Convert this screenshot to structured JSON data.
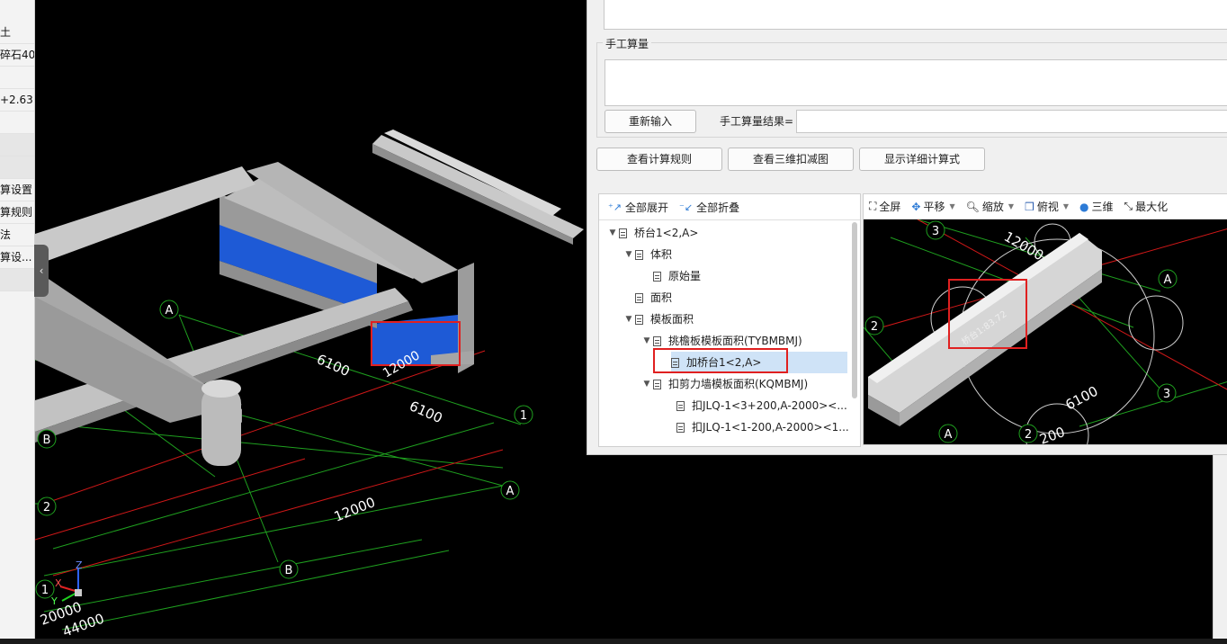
{
  "left_panel": {
    "rows": [
      "土",
      "碎石40",
      "",
      "+2.63.",
      "",
      "",
      "",
      "算设置",
      "算规则",
      "法",
      "算设..."
    ]
  },
  "viewport": {
    "axis_labels": [
      "A",
      "B",
      "2",
      "1",
      "A",
      "B",
      "1"
    ],
    "dims": [
      "6100",
      "6100",
      "12000",
      "12000",
      "20000",
      "44000"
    ],
    "gizmo": {
      "x": "X",
      "y": "Y",
      "z": "Z"
    }
  },
  "panel": {
    "manual_group_title": "手工算量",
    "reinput_button": "重新输入",
    "result_label": "手工算量结果=",
    "view_rules_button": "查看计算规则",
    "view_3d_button": "查看三维扣减图",
    "show_formula_button": "显示详细计算式"
  },
  "tree_toolbar": {
    "expand_all": "全部展开",
    "collapse_all": "全部折叠"
  },
  "tree": [
    {
      "label": "桥台1<2,A>",
      "level": 0,
      "arrow": "down"
    },
    {
      "label": "体积",
      "level": 1,
      "arrow": "down"
    },
    {
      "label": "原始量",
      "level": 2,
      "arrow": "none"
    },
    {
      "label": "面积",
      "level": 1,
      "arrow": "none"
    },
    {
      "label": "模板面积",
      "level": 1,
      "arrow": "down"
    },
    {
      "label": "挑檐板模板面积(TYBMBMJ)",
      "level": 2,
      "arrow": "down"
    },
    {
      "label": "加桥台1<2,A>",
      "level": 3,
      "arrow": "none",
      "selected": true
    },
    {
      "label": "扣剪力墙模板面积(KQMBMJ)",
      "level": 2,
      "arrow": "down"
    },
    {
      "label": "扣JLQ-1<3+200,A-2000><...",
      "level": 3,
      "arrow": "none"
    },
    {
      "label": "扣JLQ-1<1-200,A-2000><1...",
      "level": 3,
      "arrow": "none"
    }
  ],
  "view_toolbar": {
    "fullscreen": "全屏",
    "pan": "平移",
    "zoom": "缩放",
    "top_view": "俯视",
    "three_d": "三维",
    "maximize": "最大化"
  },
  "mini_view": {
    "labels": [
      "3",
      "2",
      "A",
      "3",
      "A",
      "2"
    ],
    "dims": [
      "12000",
      "6100",
      "200"
    ],
    "element_label": "桥台1:83.72"
  },
  "colors": {
    "accent_blue": "#2d7bd6",
    "highlight_red": "#e02020",
    "grid_green": "#1fa01f",
    "grid_red": "#d01818",
    "slab_blue": "#1e5ad6"
  }
}
